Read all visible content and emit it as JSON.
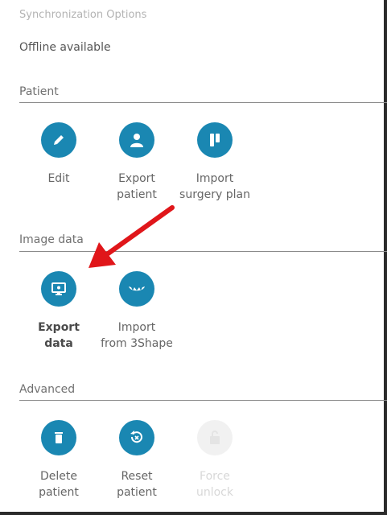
{
  "sync": {
    "title": "Synchronization Options",
    "value": "Offline available"
  },
  "sections": [
    {
      "title": "Patient",
      "actions": [
        {
          "label": "Edit",
          "icon": "pencil-icon"
        },
        {
          "label": "Export\npatient",
          "icon": "person-icon"
        },
        {
          "label": "Import\nsurgery plan",
          "icon": "implant-icon"
        }
      ]
    },
    {
      "title": "Image data",
      "actions": [
        {
          "label": "Export\ndata",
          "icon": "monitor-icon"
        },
        {
          "label": "Import\nfrom 3Shape",
          "icon": "teeth-icon"
        }
      ]
    },
    {
      "title": "Advanced",
      "actions": [
        {
          "label": "Delete\npatient",
          "icon": "trash-icon"
        },
        {
          "label": "Reset\npatient",
          "icon": "reset-icon"
        },
        {
          "label": "Force\nunlock",
          "icon": "unlock-icon"
        }
      ]
    }
  ],
  "colors": {
    "accent": "#1a87b2",
    "arrow": "#e0161a"
  }
}
